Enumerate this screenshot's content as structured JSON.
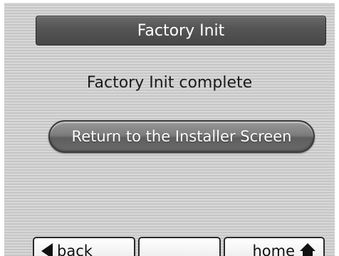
{
  "header": {
    "title": "Factory Init"
  },
  "main": {
    "status_message": "Factory Init complete",
    "return_button_label": "Return to the Installer Screen"
  },
  "footer": {
    "back_label": "back",
    "middle_label": "",
    "home_label": "home",
    "back_icon": "arrow-left-icon",
    "home_icon": "house-icon"
  },
  "colors": {
    "background": "#d4d4d4",
    "title_bar": "#555555",
    "button": "#7c7c7c",
    "nav_button": "#f2f2f2"
  }
}
